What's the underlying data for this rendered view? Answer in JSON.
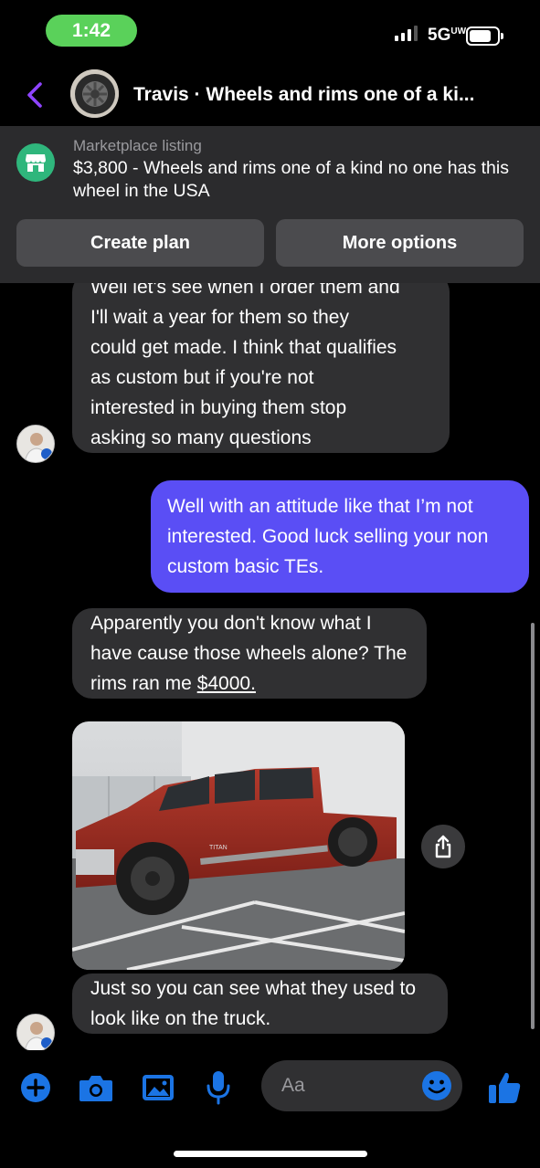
{
  "status_bar": {
    "time": "1:42",
    "network": "5G",
    "network_sup": "UW",
    "time_pill_color": "#5ad15a"
  },
  "header": {
    "title": "Travis · Wheels and rims one of a ki...",
    "back_icon": "chevron-left-icon",
    "accent": "#8e44ff"
  },
  "marketplace": {
    "label": "Marketplace listing",
    "title": "$3,800 - Wheels and rims one of a kind no one has this wheel in the USA",
    "icon": "storefront-icon",
    "icon_color": "#2fb67c",
    "buttons": {
      "create_plan": "Create plan",
      "more_options": "More options"
    }
  },
  "messages": [
    {
      "direction": "received",
      "lines": [
        "Well let's see when I order them and",
        "I'll wait a year for them so they",
        "could get made. I think that qualifies",
        "as custom but if you're not",
        "interested in buying them stop",
        "asking so many questions"
      ]
    },
    {
      "direction": "sent",
      "text": "Well with an attitude like that I’m not interested. Good luck selling your non custom basic TEs."
    },
    {
      "direction": "received",
      "text_before": "Apparently you don't know what I have cause those wheels alone? The rims ran me ",
      "amount": "$4000."
    },
    {
      "direction": "received",
      "type": "photo",
      "photo_label": "TITAN"
    },
    {
      "direction": "received",
      "text": "Just so you can see what they used to look like on the truck."
    }
  ],
  "composer": {
    "placeholder": "Aa",
    "icons": [
      "plus-icon",
      "camera-icon",
      "gallery-icon",
      "microphone-icon",
      "emoji-icon",
      "thumbs-up-icon"
    ],
    "icon_color": "#1b74e4"
  },
  "colors": {
    "sent_bubble": "#5a4ef5",
    "received_bubble": "#303032",
    "panel": "#2b2b2d"
  }
}
